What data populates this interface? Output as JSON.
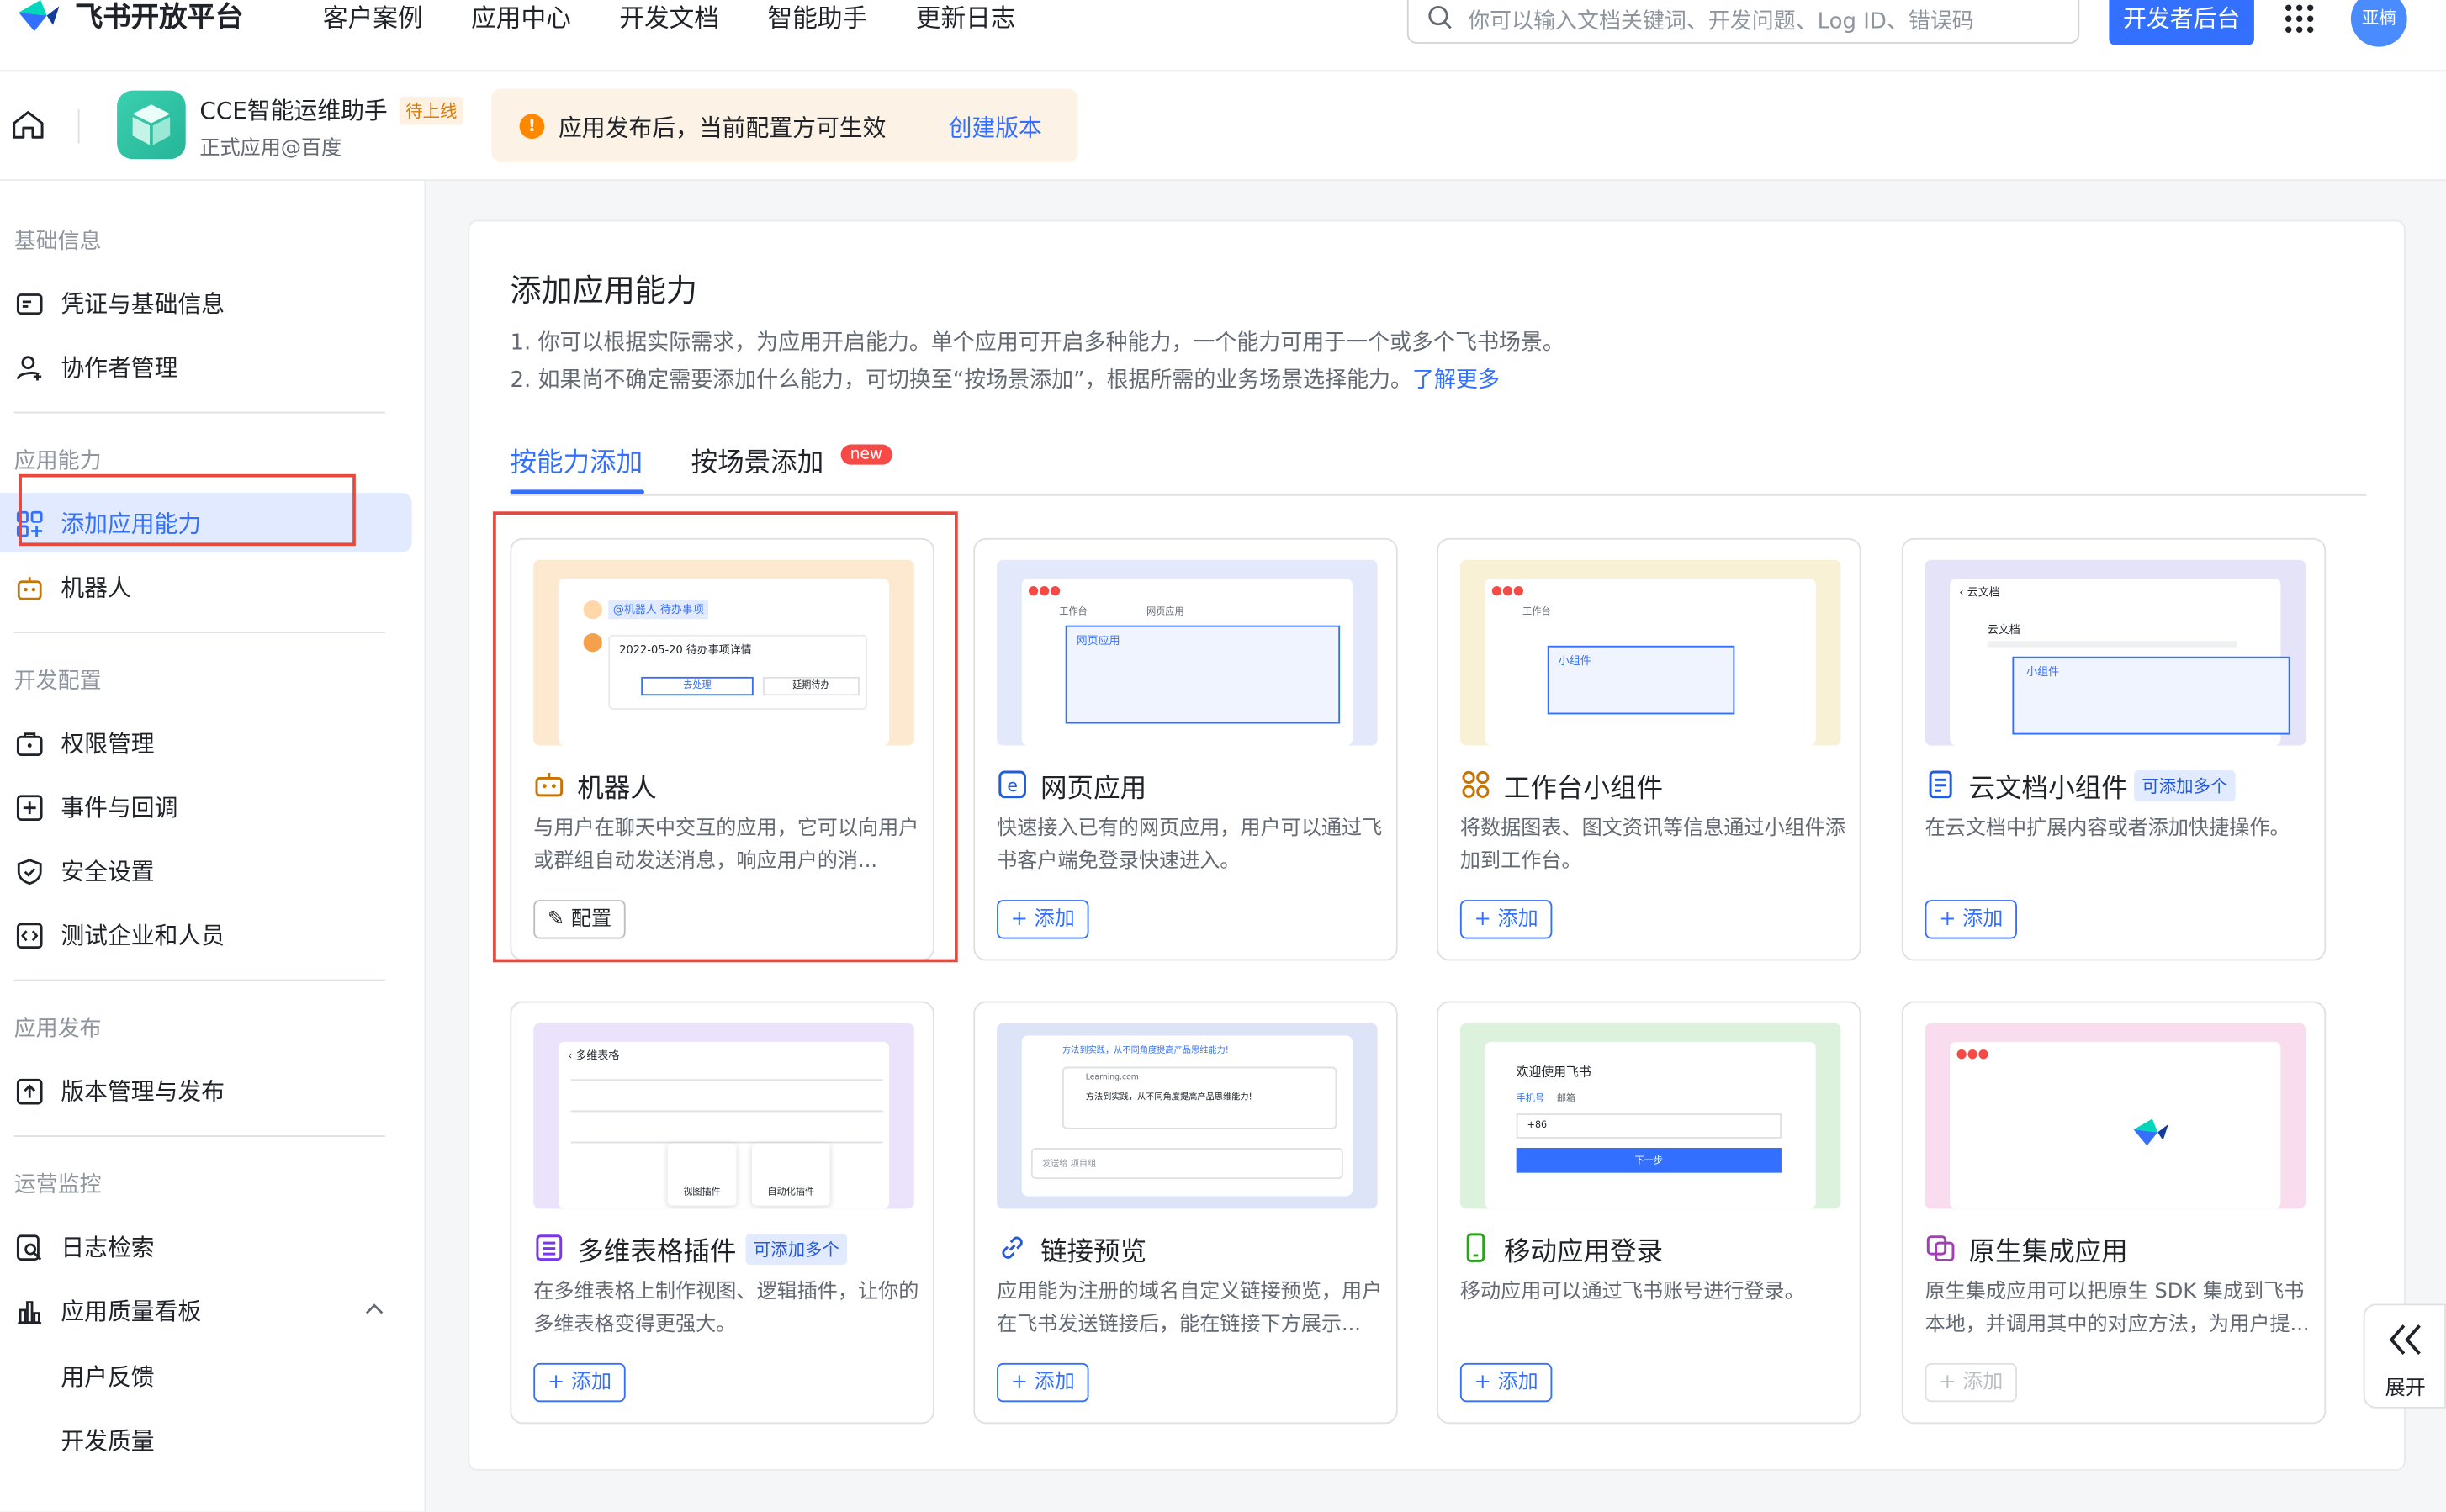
{
  "topnav": {
    "brand": "飞书开放平台",
    "links": [
      "客户案例",
      "应用中心",
      "开发文档",
      "智能助手",
      "更新日志"
    ],
    "search_placeholder": "你可以输入文档关键词、开发问题、Log ID、错误码",
    "dev_console_label": "开发者后台",
    "avatar_text": "亚楠"
  },
  "appbar": {
    "app_name": "CCE智能运维助手",
    "status_badge": "待上线",
    "app_subtitle": "正式应用@百度",
    "notice_text": "应用发布后，当前配置方可生效",
    "notice_link": "创建版本"
  },
  "sidebar": {
    "sections": [
      {
        "title": "基础信息",
        "items": [
          "凭证与基础信息",
          "协作者管理"
        ]
      },
      {
        "title": "应用能力",
        "items": [
          "添加应用能力",
          "机器人"
        ]
      },
      {
        "title": "开发配置",
        "items": [
          "权限管理",
          "事件与回调",
          "安全设置",
          "测试企业和人员"
        ]
      },
      {
        "title": "应用发布",
        "items": [
          "版本管理与发布"
        ]
      },
      {
        "title": "运营监控",
        "items": [
          "日志检索",
          "应用质量看板"
        ]
      }
    ],
    "subitems": [
      "用户反馈",
      "开发质量"
    ],
    "active_item": "添加应用能力"
  },
  "main": {
    "title": "添加应用能力",
    "desc1": "1. 你可以根据实际需求，为应用开启能力。单个应用可开启多种能力，一个能力可用于一个或多个飞书场景。",
    "desc2": "2. 如果尚不确定需要添加什么能力，可切换至“按场景添加”，根据所需的业务场景选择能力。",
    "desc2_link": "了解更多",
    "tabs": [
      "按能力添加",
      "按场景添加"
    ],
    "new_badge": "new",
    "cards": [
      {
        "name": "机器人",
        "desc": "与用户在聊天中交互的应用，它可以向用户或群组自动发送消息，响应用户的消...",
        "button": "配置"
      },
      {
        "name": "网页应用",
        "desc": "快速接入已有的网页应用，用户可以通过飞书客户端免登录快速进入。",
        "button": "添加"
      },
      {
        "name": "工作台小组件",
        "desc": "将数据图表、图文资讯等信息通过小组件添加到工作台。",
        "button": "添加"
      },
      {
        "name": "云文档小组件",
        "badge": "可添加多个",
        "desc": "在云文档中扩展内容或者添加快捷操作。",
        "button": "添加"
      },
      {
        "name": "多维表格插件",
        "badge": "可添加多个",
        "desc": "在多维表格上制作视图、逻辑插件，让你的多维表格变得更强大。",
        "button": "添加"
      },
      {
        "name": "链接预览",
        "desc": "应用能为注册的域名自定义链接预览，用户在飞书发送链接后，能在链接下方展示...",
        "button": "添加"
      },
      {
        "name": "移动应用登录",
        "desc": "移动应用可以通过飞书账号进行登录。",
        "button": "添加"
      },
      {
        "name": "原生集成应用",
        "desc": "原生集成应用可以把原生 SDK 集成到飞书本地，并调用其中的对应方法，为用户提...",
        "button": "添加"
      }
    ],
    "thumbs": {
      "bot_tag": "@机器人 待办事项",
      "bot_msg": "2022-05-20 待办事项详情",
      "bot_btn1": "去处理",
      "bot_btn2": "延期待办",
      "web_tab1": "工作台",
      "web_tab2": "网页应用",
      "web_label": "网页应用",
      "widget_tab": "工作台",
      "widget_label": "小组件",
      "doc_title": "云文档",
      "doc_heading": "云文档",
      "doc_label": "小组件",
      "base_title": "多维表格",
      "base_plugin1": "视图插件",
      "base_plugin2": "自动化插件",
      "link_line1": "方法到实践，从不同角度提高产品思维能力!",
      "link_site": "Learning.com",
      "link_line2": "方法到实践，从不同角度提高产品思维能力!",
      "link_input": "发送给 项目组",
      "mobile_title": "欢迎使用飞书",
      "mobile_tab1": "手机号",
      "mobile_tab2": "邮箱",
      "mobile_code": "+86",
      "mobile_next": "下一步"
    }
  },
  "expand_label": "展开",
  "colors": {
    "accent": "#3370ff",
    "highlight_box": "#e9483c",
    "active_bg": "#e1eaff"
  }
}
